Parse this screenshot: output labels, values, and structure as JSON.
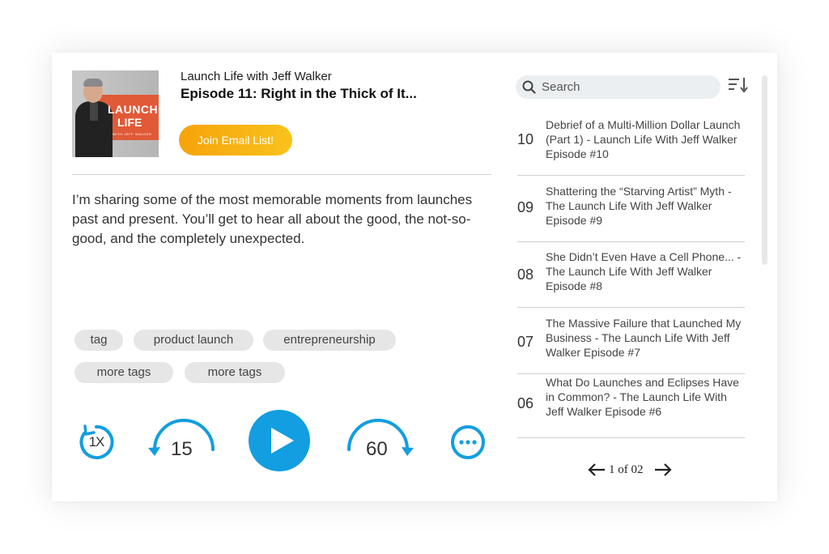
{
  "header": {
    "show_name": "Launch Life with Jeff Walker",
    "episode_title": "Episode 11: Right in the Thick of It...",
    "join_button": "Join Email List!"
  },
  "artwork": {
    "line1": "LAUNCH",
    "line2": "LIFE",
    "line3": "WITH JEFF WALKER"
  },
  "description": "I’m sharing some of the most memorable moments from launches past and present. You’ll get to hear all about the good, the not-so-good, and the completely unexpected.",
  "tags": [
    "tag",
    "product launch",
    "entrepreneurship",
    "more tags",
    "more tags"
  ],
  "controls": {
    "speed": "1X",
    "rewind": "15",
    "forward": "60"
  },
  "search": {
    "placeholder": "Search"
  },
  "episodes": [
    {
      "num": "10",
      "title": "Debrief of a Multi-Million Dollar Launch (Part 1) - Launch Life With Jeff Walker Episode #10"
    },
    {
      "num": "09",
      "title": "Shattering the “Starving Artist” Myth - The Launch Life With Jeff Walker Episode #9"
    },
    {
      "num": "08",
      "title": "She Didn’t Even Have a Cell Phone... - The Launch Life With Jeff Walker Episode #8"
    },
    {
      "num": "07",
      "title": "The Massive Failure that Launched My Business - The Launch Life With Jeff Walker Episode #7"
    },
    {
      "num": "06",
      "title": "What Do Launches and Eclipses Have in Common? - The Launch Life With Jeff Walker Episode #6"
    }
  ],
  "pager": {
    "text": "1 of 02"
  },
  "colors": {
    "accent_blue": "#129ee0",
    "button_orange": "#f6a30a",
    "tag_bg": "#e6e6e6"
  }
}
